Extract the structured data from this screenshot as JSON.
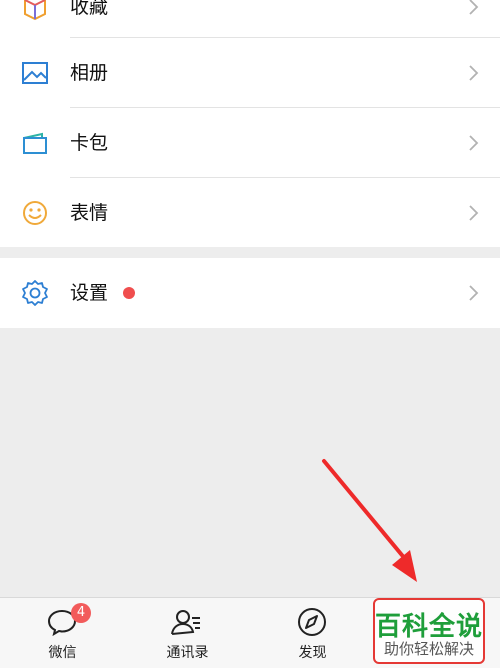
{
  "menu": {
    "favorites_label": "收藏",
    "album_label": "相册",
    "cards_label": "卡包",
    "stickers_label": "表情",
    "settings_label": "设置"
  },
  "tabbar": {
    "chats_label": "微信",
    "chats_badge": "4",
    "contacts_label": "通讯录",
    "discover_label": "发现"
  },
  "watermark": {
    "title": "百科全说",
    "subtitle": "助你轻松解决"
  },
  "colors": {
    "accent_red": "#f04e4e",
    "watermark_green": "#1e9e3a",
    "icon_blue": "#2d7fd3"
  }
}
